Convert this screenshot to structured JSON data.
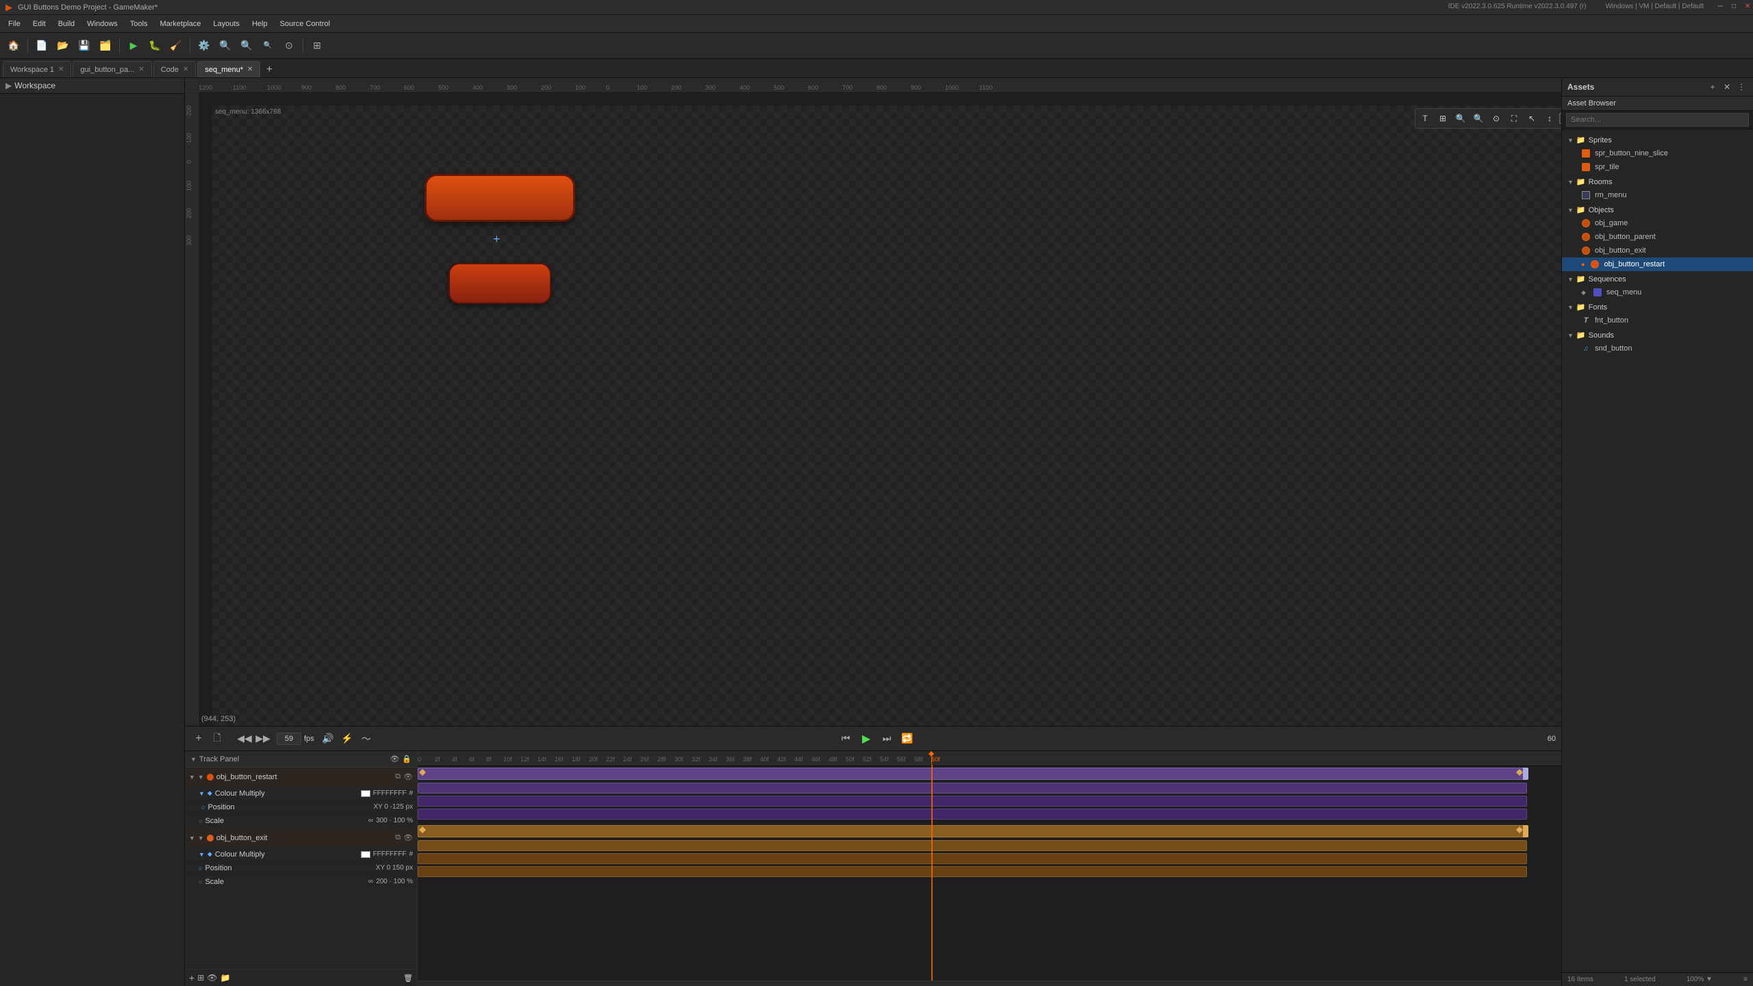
{
  "titlebar": {
    "title": "GUI Buttons Demo Project - GameMaker*",
    "ide_version": "IDE v2022.3.0.625  Runtime v2022.3.0.497 (r)",
    "win_menu": "Windows | VM | Default | Default",
    "min": "─",
    "max": "□",
    "close": "✕"
  },
  "menubar": {
    "items": [
      "File",
      "Edit",
      "Build",
      "Windows",
      "Tools",
      "Marketplace",
      "Layouts",
      "Help",
      "Source Control"
    ]
  },
  "tabs": [
    {
      "label": "Workspace 1",
      "closable": true,
      "active": false
    },
    {
      "label": "gui_button_pa...",
      "closable": true,
      "active": false
    },
    {
      "label": "Code",
      "closable": true,
      "active": false
    },
    {
      "label": "seq_menu*",
      "closable": true,
      "active": true
    }
  ],
  "canvas": {
    "seq_size": "seq_menu: 1366x768",
    "coord": "(944, 253)"
  },
  "workspace_label": "Workspace",
  "assets": {
    "panel_title": "Assets",
    "browser_label": "Asset Browser",
    "search_placeholder": "Search...",
    "tree": {
      "sprites": {
        "label": "Sprites",
        "items": [
          "spr_button_nine_slice",
          "spr_tile"
        ]
      },
      "rooms": {
        "label": "Rooms",
        "items": [
          "rm_menu"
        ]
      },
      "objects": {
        "label": "Objects",
        "items": [
          "obj_game",
          "obj_button_parent",
          "obj_button_exit",
          "obj_button_restart"
        ]
      },
      "sequences": {
        "label": "Sequences",
        "items": [
          "seq_menu"
        ]
      },
      "fonts": {
        "label": "Fonts",
        "items": [
          "fnt_button"
        ]
      },
      "sounds": {
        "label": "Sounds",
        "items": [
          "snd_button"
        ]
      }
    },
    "footer": {
      "count": "16 items",
      "selected": "1 selected",
      "zoom": "100% ▼",
      "icon": "≡"
    }
  },
  "timeline": {
    "fps_value": "59",
    "fps_label": "fps",
    "end_frame": "60",
    "track_panel_label": "Track Panel",
    "tracks": [
      {
        "name": "obj_button_restart",
        "color": "#e05010",
        "sub_tracks": [
          {
            "name": "Colour Multiply",
            "val": "FFFFFFFF",
            "type": "color"
          },
          {
            "name": "Position",
            "xy": "XY 0  -125 px"
          },
          {
            "name": "Scale",
            "val": "300 · 100 %"
          }
        ]
      },
      {
        "name": "obj_button_exit",
        "color": "#e06020",
        "sub_tracks": [
          {
            "name": "Colour Multiply",
            "val": "FFFFFFFF",
            "type": "color"
          },
          {
            "name": "Position",
            "xy": "XY 0   150 px"
          },
          {
            "name": "Scale",
            "val": "200 · 100 %"
          }
        ]
      }
    ]
  }
}
